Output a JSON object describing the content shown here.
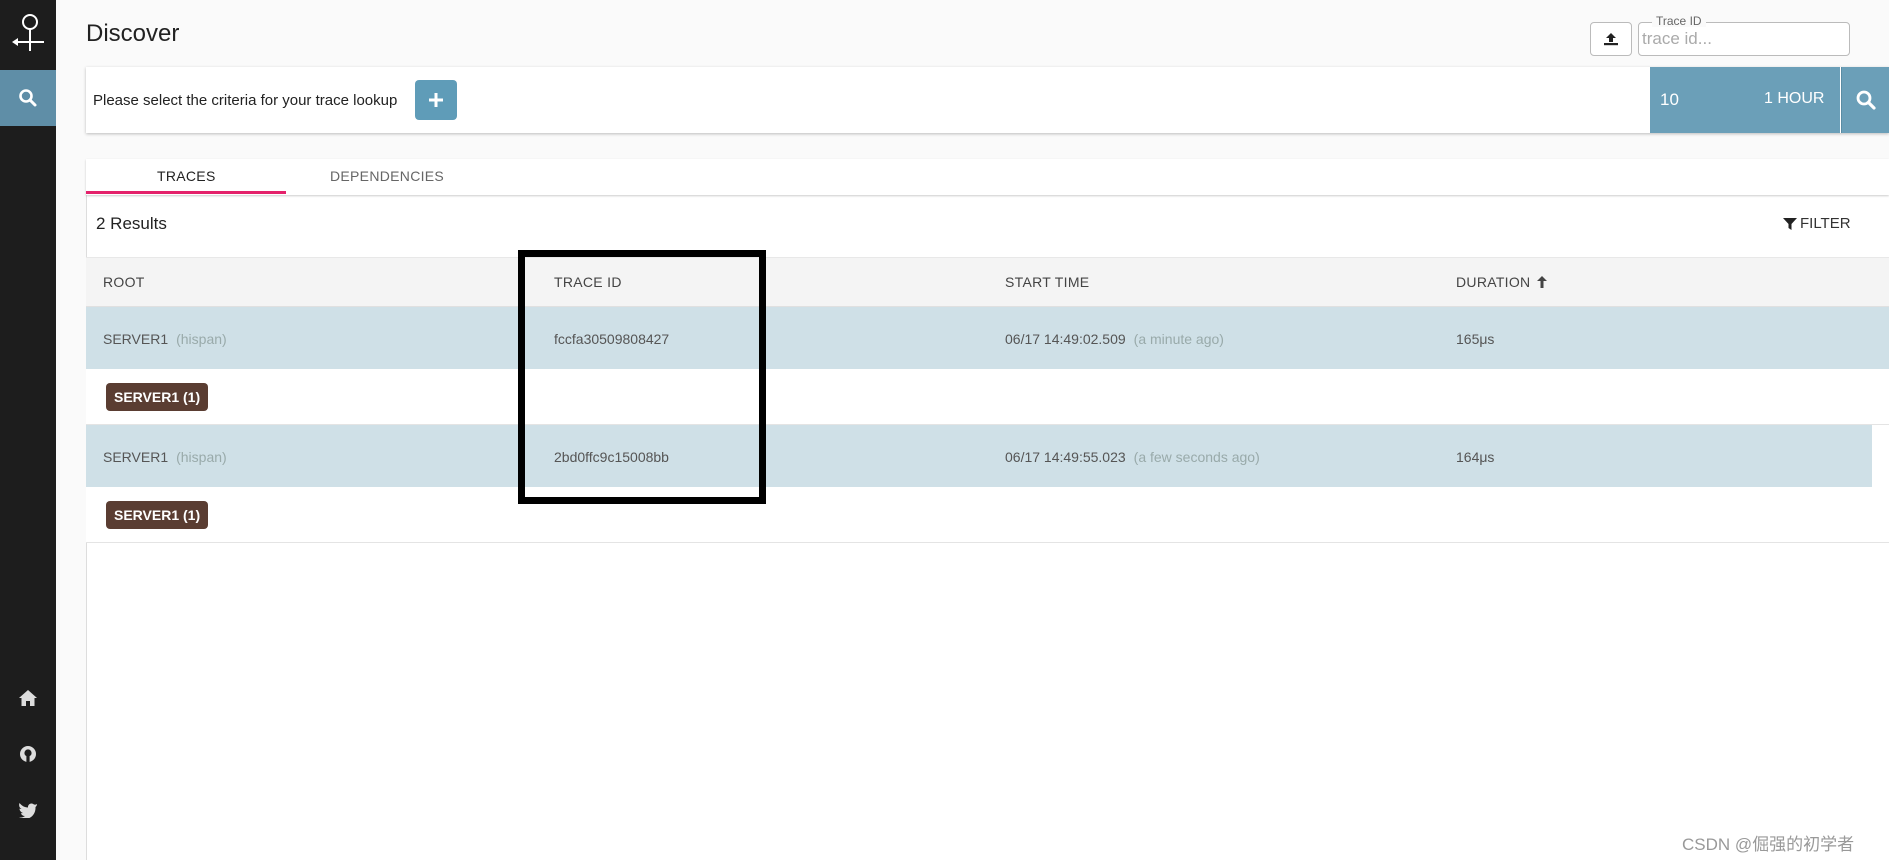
{
  "header": {
    "title": "Discover",
    "trace_id_label": "Trace ID",
    "trace_id_placeholder": "trace id..."
  },
  "criteria": {
    "prompt": "Please select the criteria for your trace lookup",
    "limit": "10",
    "range": "1 HOUR"
  },
  "tabs": [
    {
      "label": "TRACES",
      "active": true
    },
    {
      "label": "DEPENDENCIES",
      "active": false
    }
  ],
  "results": {
    "count_label": "2 Results",
    "filter_label": "FILTER",
    "columns": [
      "ROOT",
      "TRACE ID",
      "START TIME",
      "DURATION"
    ],
    "rows": [
      {
        "root": "SERVER1",
        "span": "(hispan)",
        "trace_id": "fccfa30509808427",
        "start": "06/17 14:49:02.509",
        "relative": "(a minute ago)",
        "duration": "165μs",
        "badge": "SERVER1 (1)"
      },
      {
        "root": "SERVER1",
        "span": "(hispan)",
        "trace_id": "2bd0ffc9c15008bb",
        "start": "06/17 14:49:55.023",
        "relative": "(a few seconds ago)",
        "duration": "164μs",
        "badge": "SERVER1 (1)"
      }
    ]
  },
  "watermark": "CSDN @倔强的初学者",
  "colors": {
    "sidebar": "#1d1d1d",
    "accent": "#5f8ea7",
    "tab_underline": "#e4226b",
    "row_bg": "#cfe0e7",
    "badge_bg": "#5a3d32"
  },
  "icons": {
    "logo": "zipkin-logo-icon",
    "nav": "search-icon",
    "bottom": [
      "home-icon",
      "github-icon",
      "twitter-icon"
    ],
    "upload": "upload-icon",
    "add": "plus-icon",
    "filter": "filter-icon",
    "sort": "arrow-up-icon"
  }
}
